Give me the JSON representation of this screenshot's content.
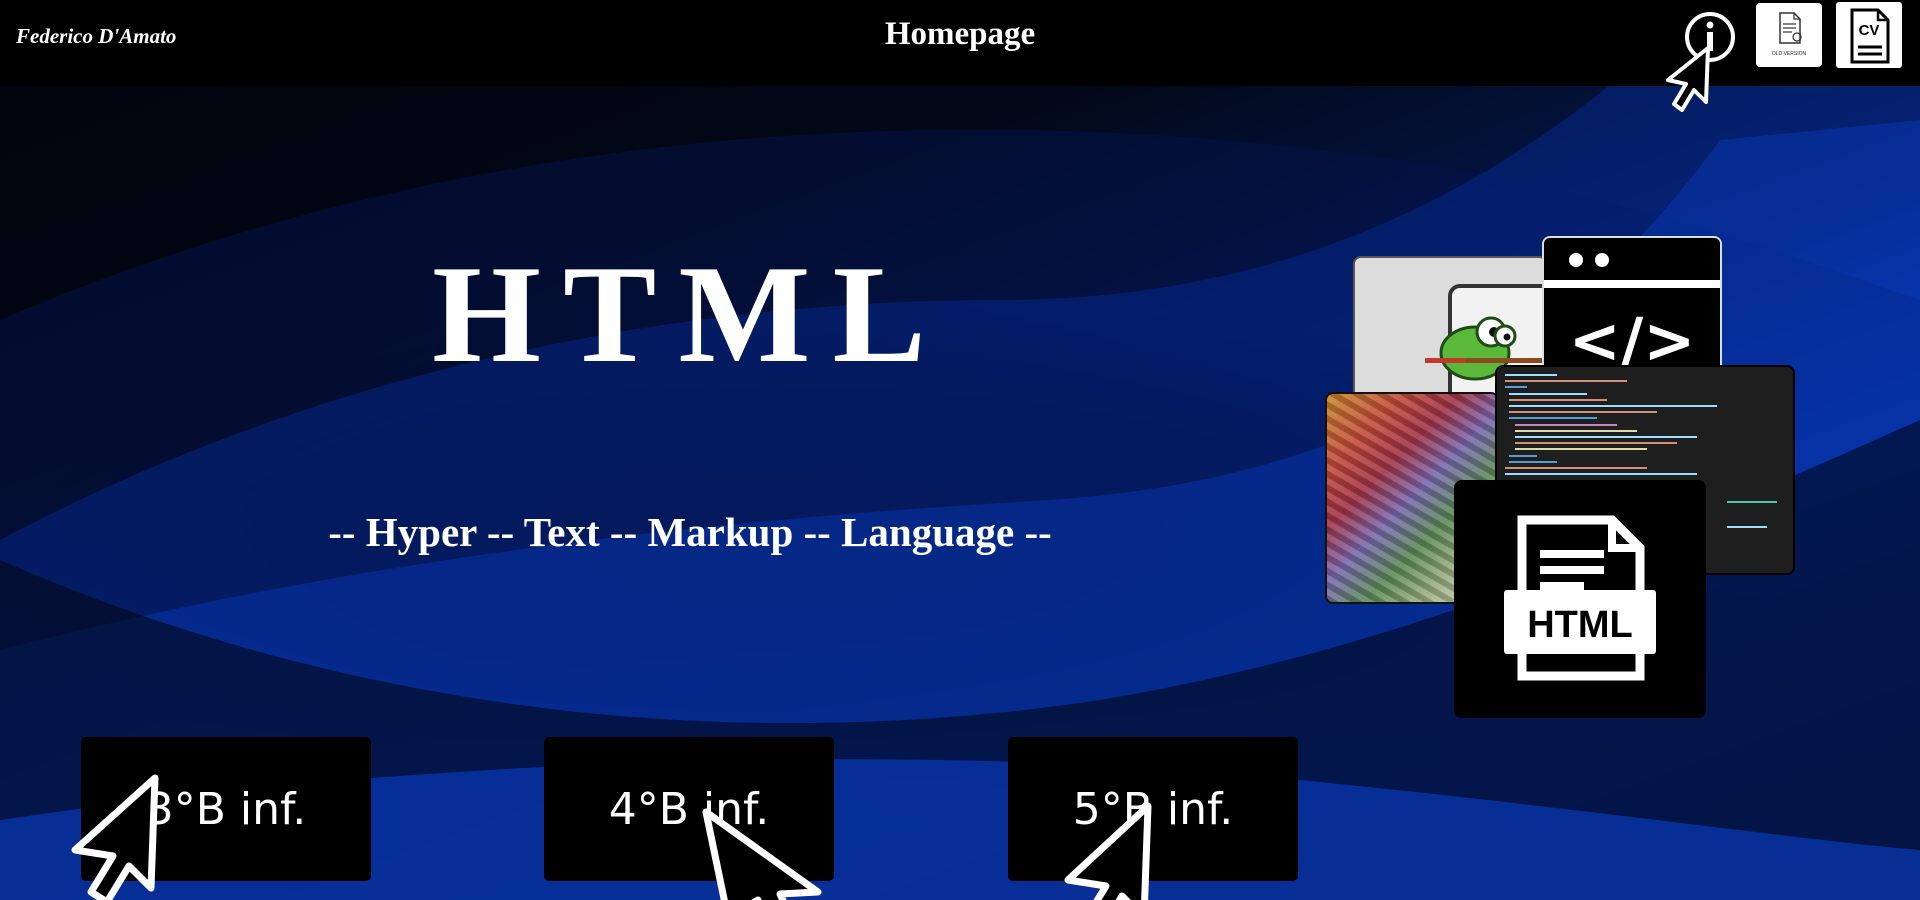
{
  "header": {
    "author": "Federico D'Amato",
    "title": "Homepage",
    "doc_caption": "OLD VERSION",
    "cv_label": "CV"
  },
  "hero": {
    "title": "HTML",
    "subtitle": "-- Hyper -- Text -- Markup -- Language --"
  },
  "collage": {
    "code_window_symbol": "</>",
    "html_badge": "HTML"
  },
  "class_buttons": [
    {
      "label": "3°B inf."
    },
    {
      "label": "4°B inf."
    },
    {
      "label": "5°B inf."
    }
  ],
  "colors": {
    "header_bg": "#000000",
    "accent_blue": "#0a3fc8",
    "button_bg": "#000000",
    "text": "#ffffff"
  },
  "icons": [
    "info-icon",
    "document-icon",
    "cv-icon",
    "cursor-icon"
  ]
}
